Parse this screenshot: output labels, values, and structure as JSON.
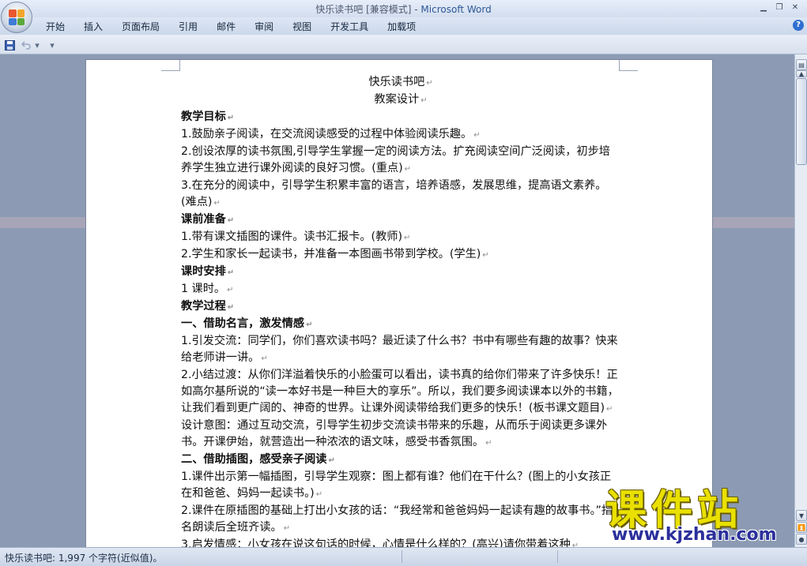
{
  "window": {
    "title_doc": "快乐读书吧 [兼容模式] - ",
    "title_app": "Microsoft Word"
  },
  "ribbon": {
    "tabs": [
      "开始",
      "插入",
      "页面布局",
      "引用",
      "邮件",
      "审阅",
      "视图",
      "开发工具",
      "加载项"
    ],
    "help_label": "?"
  },
  "qat": {
    "save_icon": "save-icon",
    "undo_icon": "undo-icon"
  },
  "document": {
    "lines": [
      {
        "text": "快乐读书吧",
        "style": "center"
      },
      {
        "text": "教案设计",
        "style": "center"
      },
      {
        "text": "教学目标",
        "style": "b"
      },
      {
        "text": "1.鼓励亲子阅读，在交流阅读感受的过程中体验阅读乐趣。",
        "style": ""
      },
      {
        "text": "2.创设浓厚的读书氛围,引导学生掌握一定的阅读方法。扩充阅读空间广泛阅读，初步培养学生独立进行课外阅读的良好习惯。(重点)",
        "style": ""
      },
      {
        "text": "3.在充分的阅读中，引导学生积累丰富的语言，培养语感，发展思维，提高语文素养。(难点)",
        "style": ""
      },
      {
        "text": "课前准备",
        "style": "b"
      },
      {
        "text": "1.带有课文插图的课件。读书汇报卡。(教师)",
        "style": ""
      },
      {
        "text": "2.学生和家长一起读书，并准备一本图画书带到学校。(学生)",
        "style": ""
      },
      {
        "text": "课时安排",
        "style": "b"
      },
      {
        "text": "1 课时。",
        "style": ""
      },
      {
        "text": "教学过程",
        "style": "b"
      },
      {
        "text": "一、借助名言，激发情感",
        "style": "b"
      },
      {
        "text": "1.引发交流：同学们，你们喜欢读书吗？最近读了什么书？书中有哪些有趣的故事？快来给老师讲一讲。",
        "style": ""
      },
      {
        "text": "2.小结过渡：从你们洋溢着快乐的小脸蛋可以看出，读书真的给你们带来了许多快乐！正如高尔基所说的“读一本好书是一种巨大的享乐”。所以，我们要多阅读课本以外的书籍，让我们看到更广阔的、神奇的世界。让课外阅读带给我们更多的快乐！(板书课文题目)",
        "style": ""
      },
      {
        "text": "设计意图：通过互动交流，引导学生初步交流读书带来的乐趣，从而乐于阅读更多课外书。开课伊始，就营造出一种浓浓的语文味，感受书香氛围。",
        "style": ""
      },
      {
        "text": "二、借助插图，感受亲子阅读",
        "style": "b"
      },
      {
        "text": "1.课件出示第一幅插图，引导学生观察：图上都有谁？他们在干什么？(图上的小女孩正在和爸爸、妈妈一起读书。)",
        "style": ""
      },
      {
        "text": "2.课件在原插图的基础上打出小女孩的话：“我经常和爸爸妈妈一起读有趣的故事书。”指名朗读后全班齐读。",
        "style": ""
      },
      {
        "text": "3.启发情感：小女孩在说这句话的时候，心情是什么样的？(高兴)请你带着这种",
        "style": ""
      }
    ]
  },
  "statusbar": {
    "text": "快乐读书吧: 1,997 个字符(近似值)。"
  },
  "watermark": {
    "title": "课件站",
    "url": "www.kjzhan.com"
  },
  "colors": {
    "workspace": "#8c9bb3",
    "accent": "#2b5797"
  }
}
